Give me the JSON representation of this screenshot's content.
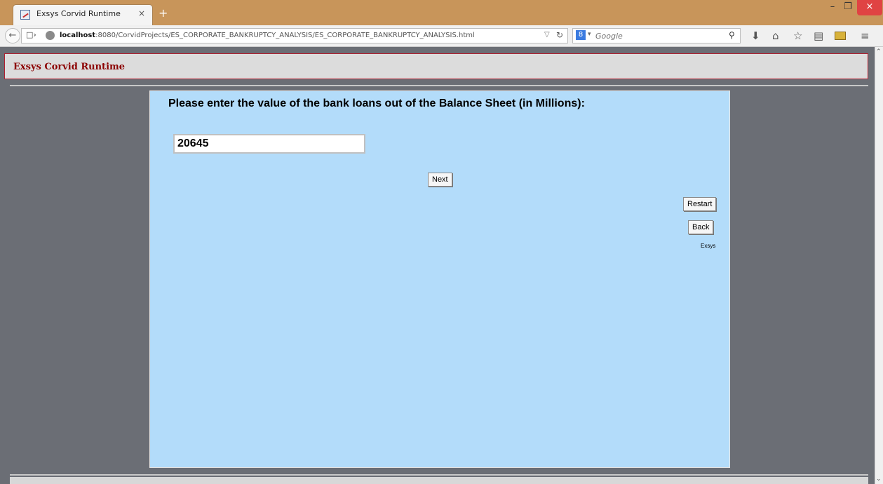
{
  "browser": {
    "tab_title": "Exsys Corvid Runtime",
    "tab_close": "×",
    "new_tab": "+",
    "window_controls": {
      "minimize": "–",
      "maximize": "❐",
      "close": "×"
    },
    "url_host": "localhost",
    "url_rest": ":8080/CorvidProjects/ES_CORPORATE_BANKRUPTCY_ANALYSIS/ES_CORPORATE_BANKRUPTCY_ANALYSIS.html",
    "search_engine": "8",
    "search_placeholder": "Google",
    "icons": [
      "back-icon",
      "page-info-icon",
      "globe-icon",
      "reload-icon",
      "search-icon",
      "download-icon",
      "home-icon",
      "star-icon",
      "reader-icon",
      "addon-icon",
      "menu-icon"
    ]
  },
  "app": {
    "header_title": "Exsys Corvid Runtime",
    "question": "Please enter the value of the bank loans out of the Balance Sheet (in Millions):",
    "answer_value": "20645",
    "next_label": "Next",
    "restart_label": "Restart",
    "back_label": "Back",
    "footer_label": "Exsys"
  },
  "colors": {
    "titlebar": "#c8955a",
    "page_background": "#6b6e75",
    "panel_background": "#b3dcfa",
    "header_text": "#8b0000",
    "header_border": "#b02030",
    "close_button": "#e04343"
  }
}
